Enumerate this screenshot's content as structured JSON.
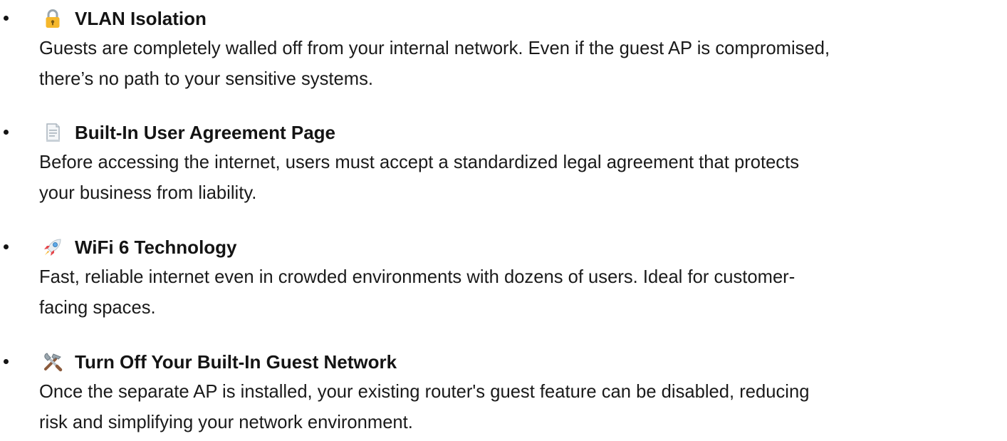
{
  "features": [
    {
      "icon": "lock-icon",
      "title": "VLAN Isolation",
      "lines": [
        "Guests are completely walled off from your internal network. Even if the guest AP is compromised,",
        "there’s no path to your sensitive systems."
      ]
    },
    {
      "icon": "document-icon",
      "title": "Built-In User Agreement Page",
      "lines": [
        "Before accessing the internet, users must accept a standardized legal agreement that protects",
        "your business from liability."
      ]
    },
    {
      "icon": "rocket-icon",
      "title": "WiFi 6 Technology",
      "lines": [
        "Fast, reliable internet even in crowded environments with dozens of users. Ideal for customer-",
        "facing spaces."
      ]
    },
    {
      "icon": "tools-icon",
      "title": "Turn Off Your Built-In Guest Network",
      "lines": [
        "Once the separate AP is installed, your existing router's guest feature can be disabled, reducing",
        "risk and simplifying your network environment."
      ]
    }
  ],
  "colors": {
    "text": "#141414",
    "lock_body": "#F5B72B",
    "lock_shackle": "#9AA6AE",
    "rocket_body": "#E8EEF2",
    "rocket_accent": "#E5484D",
    "tool_handle": "#8B5A3C"
  }
}
